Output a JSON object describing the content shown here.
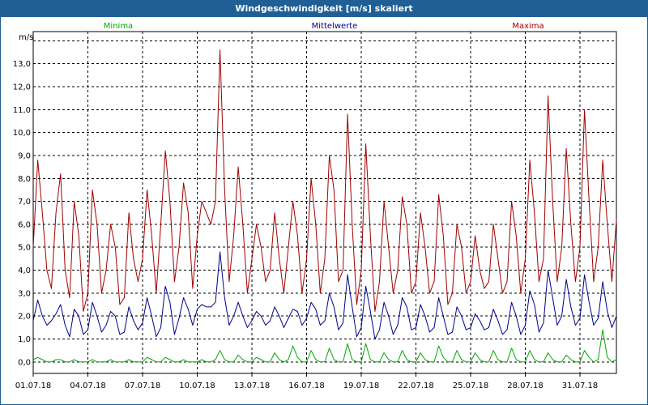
{
  "title": "Windgeschwindigkeit [m/s] skaliert",
  "chart_data": {
    "type": "line",
    "title": "Windgeschwindigkeit [m/s] skaliert",
    "ylabel": "m/s",
    "xlabel": "",
    "ylim": [
      -0.5,
      14.4
    ],
    "xlim": [
      0,
      32
    ],
    "grid": true,
    "legend_placement": "top",
    "y_ticks": [
      0,
      1,
      2,
      3,
      4,
      5,
      6,
      7,
      8,
      9,
      10,
      11,
      12,
      13
    ],
    "y_tick_labels": [
      "0,0",
      "1,0",
      "2,0",
      "3,0",
      "4,0",
      "5,0",
      "6,0",
      "7,0",
      "8,0",
      "9,0",
      "10,0",
      "11,0",
      "12,0",
      "13,0"
    ],
    "x_ticks": [
      0,
      3,
      6,
      9,
      12,
      15,
      18,
      21,
      24,
      27,
      30
    ],
    "x_tick_labels": [
      "01.07.18",
      "04.07.18",
      "07.07.18",
      "10.07.18",
      "13.07.18",
      "16.07.18",
      "19.07.18",
      "22.07.18",
      "25.07.18",
      "28.07.18",
      "31.07.18"
    ],
    "x": [
      0,
      0.25,
      0.5,
      0.75,
      1,
      1.25,
      1.5,
      1.75,
      2,
      2.25,
      2.5,
      2.75,
      3,
      3.25,
      3.5,
      3.75,
      4,
      4.25,
      4.5,
      4.75,
      5,
      5.25,
      5.5,
      5.75,
      6,
      6.25,
      6.5,
      6.75,
      7,
      7.25,
      7.5,
      7.75,
      8,
      8.25,
      8.5,
      8.75,
      9,
      9.25,
      9.5,
      9.75,
      10,
      10.25,
      10.5,
      10.75,
      11,
      11.25,
      11.5,
      11.75,
      12,
      12.25,
      12.5,
      12.75,
      13,
      13.25,
      13.5,
      13.75,
      14,
      14.25,
      14.5,
      14.75,
      15,
      15.25,
      15.5,
      15.75,
      16,
      16.25,
      16.5,
      16.75,
      17,
      17.25,
      17.5,
      17.75,
      18,
      18.25,
      18.5,
      18.75,
      19,
      19.25,
      19.5,
      19.75,
      20,
      20.25,
      20.5,
      20.75,
      21,
      21.25,
      21.5,
      21.75,
      22,
      22.25,
      22.5,
      22.75,
      23,
      23.25,
      23.5,
      23.75,
      24,
      24.25,
      24.5,
      24.75,
      25,
      25.25,
      25.5,
      25.75,
      26,
      26.25,
      26.5,
      26.75,
      27,
      27.25,
      27.5,
      27.75,
      28,
      28.25,
      28.5,
      28.75,
      29,
      29.25,
      29.5,
      29.75,
      30,
      30.25,
      30.5,
      30.75,
      31,
      31.25,
      31.5,
      31.75,
      32
    ],
    "series": [
      {
        "name": "Maxima",
        "color": "#a00000",
        "legend_position": "right",
        "values": [
          5.0,
          8.8,
          6.5,
          4.0,
          3.2,
          6.5,
          8.2,
          4.0,
          2.8,
          7.0,
          5.5,
          2.2,
          3.0,
          7.5,
          6.0,
          3.0,
          4.0,
          6.0,
          5.0,
          2.5,
          2.8,
          6.5,
          4.5,
          3.5,
          4.5,
          7.5,
          5.5,
          3.0,
          6.0,
          9.2,
          7.0,
          3.5,
          5.0,
          7.8,
          6.5,
          3.2,
          5.5,
          7.0,
          6.5,
          6.0,
          7.0,
          13.6,
          7.5,
          3.5,
          5.5,
          8.5,
          6.0,
          3.0,
          4.5,
          6.0,
          5.0,
          3.5,
          4.0,
          6.5,
          4.5,
          3.0,
          5.0,
          7.0,
          5.5,
          3.0,
          4.5,
          8.0,
          6.0,
          3.0,
          4.5,
          9.0,
          7.5,
          3.5,
          4.0,
          10.8,
          6.0,
          2.5,
          4.0,
          9.5,
          5.5,
          2.2,
          3.5,
          7.0,
          5.0,
          3.0,
          4.0,
          7.2,
          6.0,
          3.0,
          3.5,
          6.5,
          5.0,
          3.0,
          3.5,
          7.3,
          5.5,
          2.5,
          3.0,
          6.0,
          5.0,
          3.0,
          3.5,
          5.5,
          4.0,
          3.2,
          3.5,
          6.0,
          4.5,
          3.0,
          3.5,
          7.0,
          5.5,
          3.0,
          4.5,
          8.8,
          6.5,
          3.5,
          4.5,
          11.6,
          7.0,
          3.5,
          5.0,
          9.3,
          6.0,
          3.5,
          5.0,
          11.0,
          7.0,
          3.5,
          5.0,
          8.8,
          6.0,
          3.5,
          6.2
        ]
      },
      {
        "name": "Mittelwerte",
        "color": "#00008b",
        "legend_position": "center",
        "values": [
          1.8,
          2.7,
          2.0,
          1.6,
          1.8,
          2.1,
          2.5,
          1.6,
          1.1,
          2.3,
          2.0,
          1.2,
          1.4,
          2.6,
          2.0,
          1.3,
          1.6,
          2.2,
          2.0,
          1.2,
          1.3,
          2.4,
          1.8,
          1.4,
          1.7,
          2.8,
          2.0,
          1.1,
          1.5,
          3.3,
          2.6,
          1.2,
          1.9,
          2.8,
          2.3,
          1.6,
          2.3,
          2.5,
          2.4,
          2.4,
          2.6,
          4.8,
          2.8,
          1.6,
          2.0,
          2.6,
          2.0,
          1.5,
          1.8,
          2.2,
          2.0,
          1.6,
          1.8,
          2.4,
          2.0,
          1.5,
          1.9,
          2.3,
          2.2,
          1.6,
          1.9,
          2.6,
          2.3,
          1.6,
          1.8,
          3.0,
          2.4,
          1.4,
          1.7,
          3.8,
          2.4,
          1.1,
          1.5,
          3.3,
          2.2,
          1.0,
          1.4,
          2.6,
          2.0,
          1.2,
          1.6,
          2.8,
          2.4,
          1.4,
          1.5,
          2.5,
          2.0,
          1.3,
          1.5,
          2.8,
          2.0,
          1.2,
          1.3,
          2.4,
          2.0,
          1.4,
          1.5,
          2.1,
          1.8,
          1.4,
          1.5,
          2.3,
          1.8,
          1.2,
          1.4,
          2.6,
          2.0,
          1.2,
          1.6,
          3.1,
          2.5,
          1.3,
          1.7,
          4.0,
          2.8,
          1.6,
          2.0,
          3.6,
          2.4,
          1.6,
          1.9,
          3.8,
          2.6,
          1.6,
          1.9,
          3.5,
          2.2,
          1.5,
          2.0
        ]
      },
      {
        "name": "Minima",
        "color": "#00aa00",
        "legend_position": "left",
        "values": [
          0.1,
          0.2,
          0.1,
          0.0,
          0.0,
          0.1,
          0.1,
          0.0,
          0.0,
          0.1,
          0.0,
          0.0,
          0.0,
          0.1,
          0.0,
          0.0,
          0.0,
          0.1,
          0.0,
          0.0,
          0.0,
          0.1,
          0.0,
          0.0,
          0.0,
          0.2,
          0.1,
          0.0,
          0.0,
          0.2,
          0.1,
          0.0,
          0.0,
          0.1,
          0.0,
          0.0,
          0.0,
          0.1,
          0.0,
          0.0,
          0.1,
          0.5,
          0.1,
          0.0,
          0.0,
          0.3,
          0.1,
          0.0,
          0.0,
          0.2,
          0.1,
          0.0,
          0.0,
          0.4,
          0.1,
          0.0,
          0.1,
          0.7,
          0.2,
          0.0,
          0.0,
          0.5,
          0.1,
          0.0,
          0.0,
          0.6,
          0.1,
          0.0,
          0.0,
          0.8,
          0.1,
          0.0,
          0.0,
          0.8,
          0.1,
          0.0,
          0.0,
          0.4,
          0.1,
          0.0,
          0.0,
          0.5,
          0.1,
          0.0,
          0.0,
          0.4,
          0.1,
          0.0,
          0.0,
          0.7,
          0.2,
          0.0,
          0.0,
          0.5,
          0.1,
          0.0,
          0.0,
          0.4,
          0.1,
          0.0,
          0.0,
          0.5,
          0.1,
          0.0,
          0.0,
          0.6,
          0.1,
          0.0,
          0.0,
          0.5,
          0.1,
          0.0,
          0.0,
          0.4,
          0.1,
          0.0,
          0.0,
          0.3,
          0.1,
          0.0,
          0.0,
          0.5,
          0.2,
          0.0,
          0.1,
          1.4,
          0.2,
          0.0,
          0.1
        ]
      }
    ]
  }
}
